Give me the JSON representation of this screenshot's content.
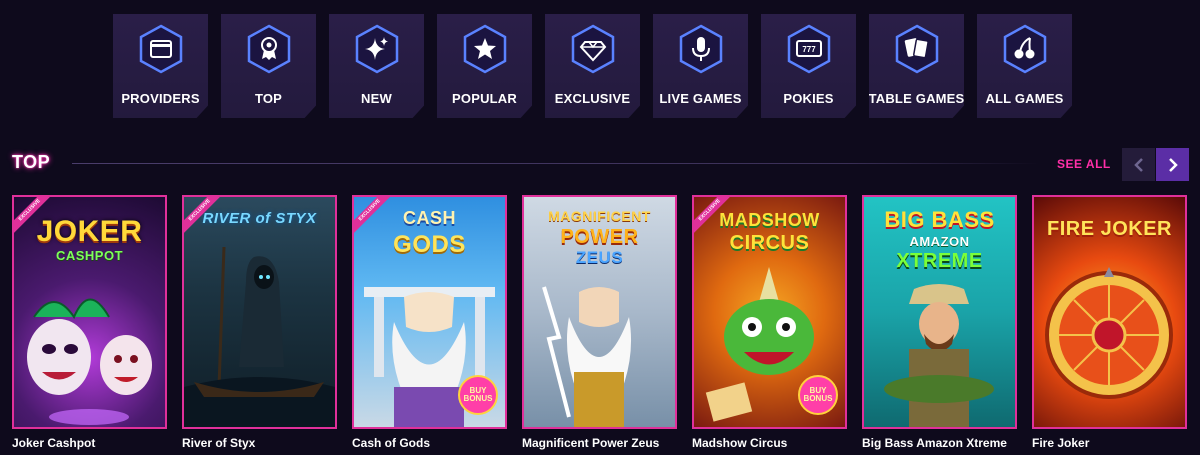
{
  "categories": [
    {
      "label": "PROVIDERS",
      "icon": "wallet-icon"
    },
    {
      "label": "TOP",
      "icon": "medal-icon"
    },
    {
      "label": "NEW",
      "icon": "sparkle-icon"
    },
    {
      "label": "POPULAR",
      "icon": "star-icon"
    },
    {
      "label": "EXCLUSIVE",
      "icon": "diamond-icon"
    },
    {
      "label": "LIVE GAMES",
      "icon": "microphone-icon"
    },
    {
      "label": "POKIES",
      "icon": "slot-machine-icon"
    },
    {
      "label": "TABLE GAMES",
      "icon": "cards-icon"
    },
    {
      "label": "ALL GAMES",
      "icon": "cherries-icon"
    }
  ],
  "section": {
    "title": "TOP",
    "see_all": "SEE ALL",
    "prev_icon": "chevron-left-icon",
    "next_icon": "chevron-right-icon"
  },
  "games": [
    {
      "title": "Joker Cashpot",
      "ribbon": "EXCLUSIVE",
      "logo_line1": "JOKER",
      "logo_line2": "CASHPOT"
    },
    {
      "title": "River of Styx",
      "ribbon": "EXCLUSIVE",
      "logo_line1": "RIVER of STYX",
      "logo_line2": ""
    },
    {
      "title": "Cash of Gods",
      "ribbon": "EXCLUSIVE",
      "logo_line1": "CASH",
      "logo_line2": "GODS",
      "badge": "BUY BONUS"
    },
    {
      "title": "Magnificent Power Zeus",
      "ribbon": "",
      "logo_line1": "MAGNIFICENT",
      "logo_line2": "POWER",
      "logo_line3": "ZEUS"
    },
    {
      "title": "Madshow Circus",
      "ribbon": "EXCLUSIVE",
      "logo_line1": "MADSHOW",
      "logo_line2": "CIRCUS",
      "badge": "BUY BONUS"
    },
    {
      "title": "Big Bass Amazon Xtreme",
      "ribbon": "",
      "logo_line1": "BIG BASS",
      "logo_line2": "AMAZON",
      "logo_line3": "XTREME"
    },
    {
      "title": "Fire Joker",
      "ribbon": "",
      "logo_line1": "FIRE JOKER",
      "logo_line2": ""
    }
  ],
  "colors": {
    "accent_pink": "#e0309a",
    "accent_purple": "#5b2ea6",
    "tile_bg": "#2a1e48",
    "icon_blue": "#3d6bff",
    "page_bg": "#0e0a1c"
  }
}
